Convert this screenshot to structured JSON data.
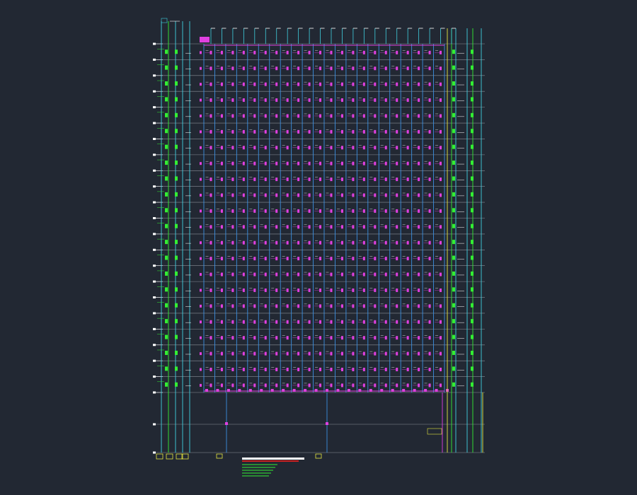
{
  "drawing": {
    "background": "#222833",
    "floors": 22,
    "bays": 22,
    "colors": {
      "floor_line": "#8a8f99",
      "riser": "#3b8fe0",
      "riser_cyan": "#40d0e0",
      "riser_green": "#33ee33",
      "riser_yellow": "#e6e640",
      "fixture": "#e040e0",
      "fixture_green": "#33ee33",
      "label_white": "#ffffff",
      "note_red": "#cc2222",
      "note_green": "#33ee33"
    },
    "note_lines_count": 5
  }
}
